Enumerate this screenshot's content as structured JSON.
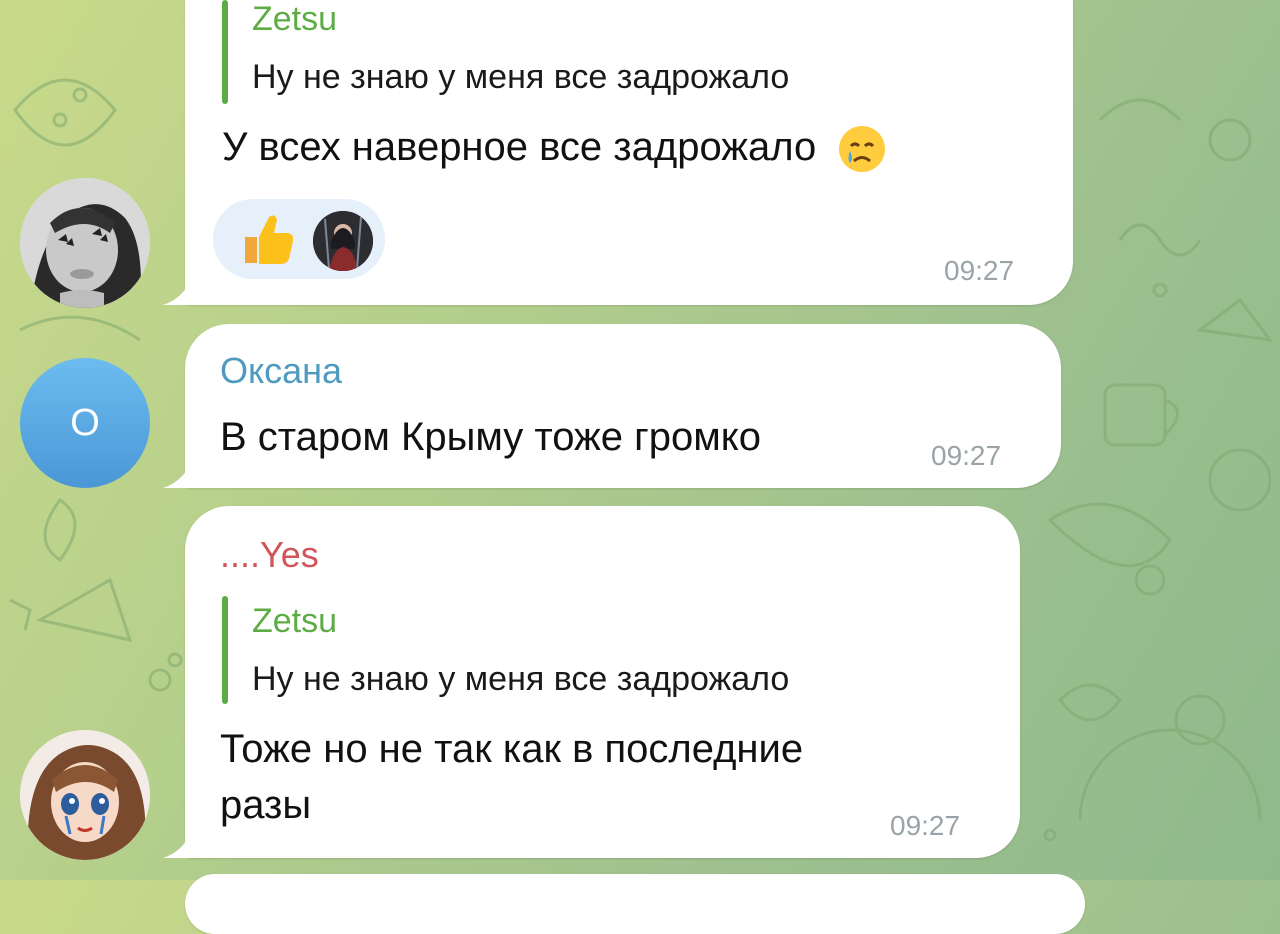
{
  "messages": [
    {
      "reply": {
        "name": "Zetsu",
        "text": "Ну не знаю у меня все задрожало"
      },
      "text": "У всех наверное все задрожало",
      "inline_emoji": "crying-face-icon",
      "reactions": [
        "thumbs-up-icon",
        "reactor-avatar"
      ],
      "time": "09:27"
    },
    {
      "sender": "Оксана",
      "sender_color": "#4f9bc0",
      "avatar_letter": "О",
      "text": "В старом Крыму тоже громко",
      "time": "09:27"
    },
    {
      "sender": "....Yes",
      "sender_color": "#d0565b",
      "reply": {
        "name": "Zetsu",
        "text": "Ну не знаю у меня все задрожало"
      },
      "text_line1": "Тоже но не так как в последние",
      "text_line2": "разы",
      "time": "09:27"
    }
  ],
  "colors": {
    "accent_green": "#5dac46",
    "bubble": "#ffffff",
    "avatar_blue": "#5aa7dd",
    "time_gray": "#9aa3a8"
  }
}
